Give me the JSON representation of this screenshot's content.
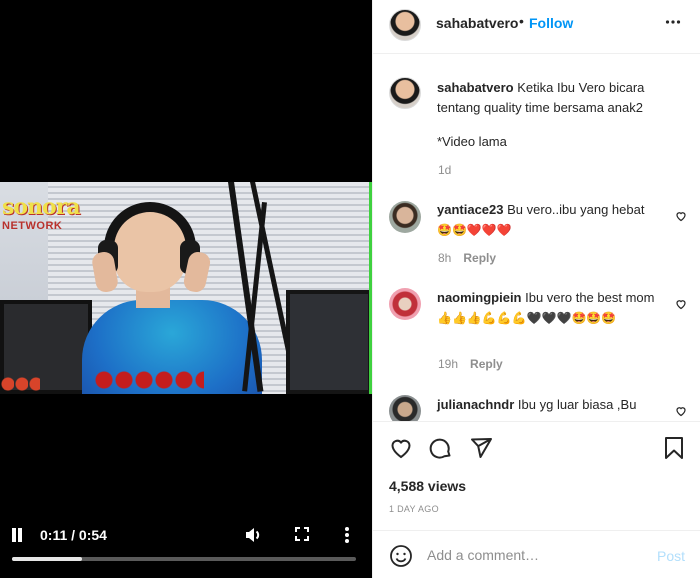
{
  "video": {
    "logo_main": "sonora",
    "logo_sub": "NETWORK",
    "time_display": "0:11 / 0:54",
    "progress_fraction": 0.204
  },
  "header": {
    "username": "sahabatvero",
    "separator": "•",
    "follow_label": "Follow",
    "more_icon": "more-horizontal-icon"
  },
  "caption": {
    "username": "sahabatvero",
    "text": "Ketika Ibu Vero bicara tentang quality time bersama anak2",
    "note": "*Video lama",
    "age": "1d"
  },
  "comments": [
    {
      "username": "yantiace23",
      "text": "Bu vero..ibu yang hebat",
      "emojis": "🤩🤩❤️❤️❤️",
      "age": "8h",
      "reply_label": "Reply"
    },
    {
      "username": "naomingpiein",
      "text": "Ibu vero the best mom",
      "emojis": "👍👍👍💪💪💪🖤🖤🖤🤩🤩🤩",
      "age": "19h",
      "reply_label": "Reply"
    },
    {
      "username": "julianachndr",
      "text": "Ibu yg luar biasa ,Bu"
    }
  ],
  "stats": {
    "views": "4,588 views",
    "date": "1 DAY AGO"
  },
  "add_comment": {
    "placeholder": "Add a comment…",
    "post_label": "Post"
  },
  "colors": {
    "accent": "#0095f6",
    "post_disabled": "#b2dffc",
    "muted": "#8e8e8e",
    "text": "#262626"
  }
}
